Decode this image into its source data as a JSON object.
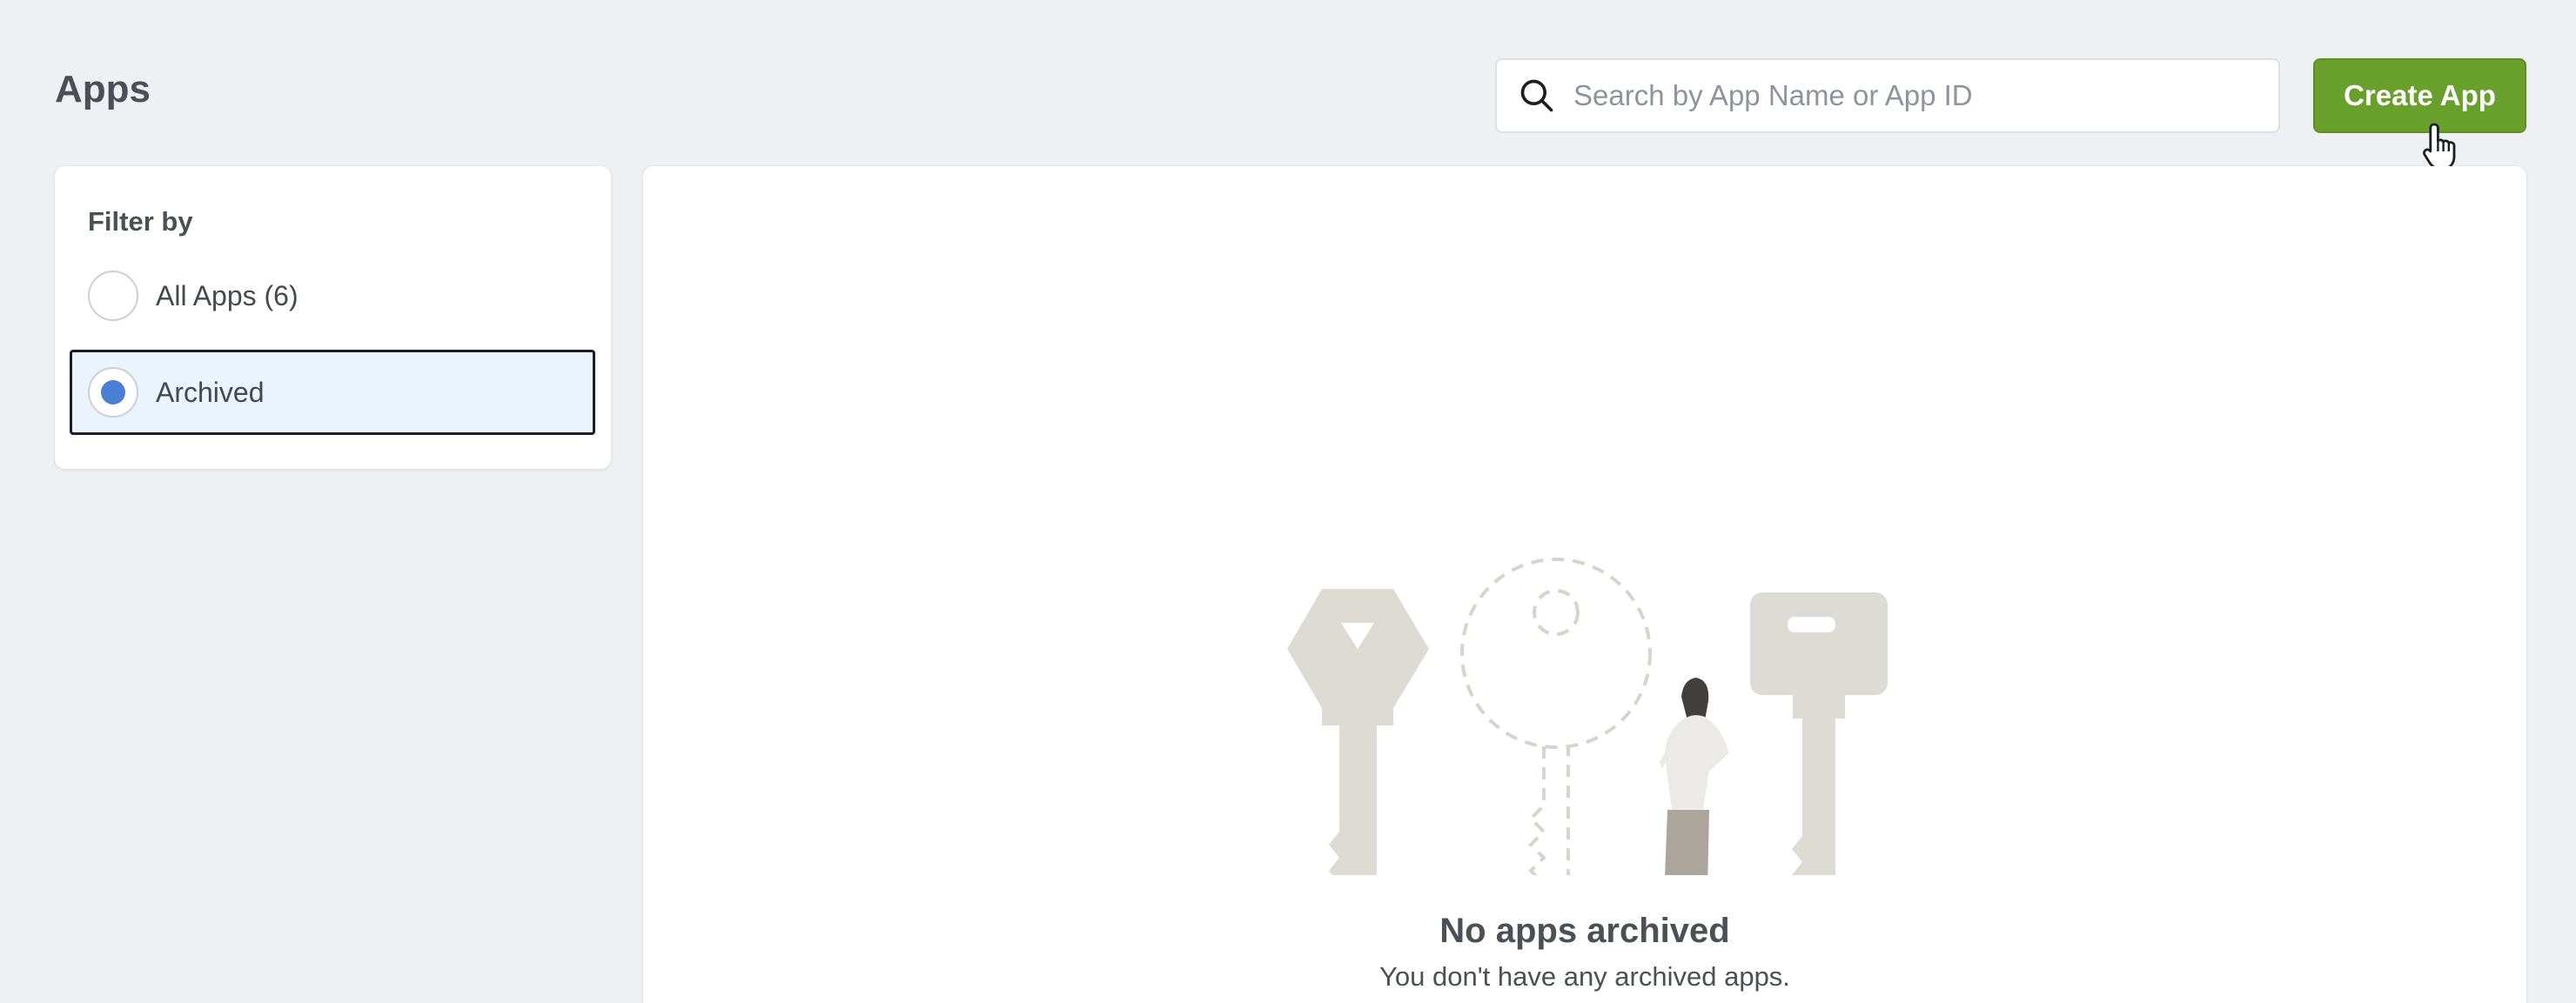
{
  "header": {
    "title": "Apps",
    "search": {
      "placeholder": "Search by App Name or App ID",
      "value": ""
    },
    "create_button_label": "Create App"
  },
  "filter": {
    "heading": "Filter by",
    "options": [
      {
        "label": "All Apps (6)",
        "selected": false
      },
      {
        "label": "Archived",
        "selected": true
      }
    ]
  },
  "empty_state": {
    "title": "No apps archived",
    "subtitle": "You don't have any archived apps."
  },
  "colors": {
    "accent_green": "#69a02b",
    "radio_selected": "#4a7fd6",
    "selected_row_bg": "#ebf3fe"
  }
}
